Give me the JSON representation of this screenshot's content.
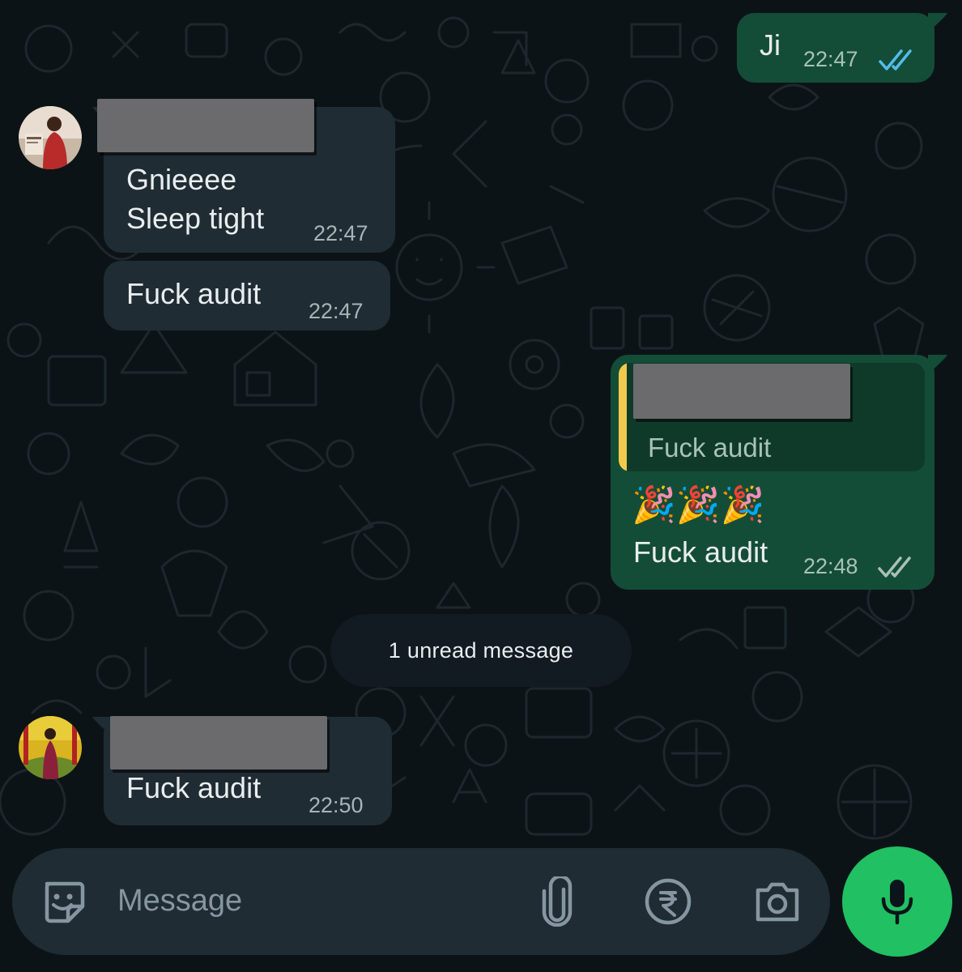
{
  "messages": {
    "out1": {
      "text": "Ji",
      "time": "22:47",
      "status": "read"
    },
    "in1": {
      "text": "Gnieeee\nSleep tight",
      "time": "22:47"
    },
    "in2": {
      "text": "Fuck audit",
      "time": "22:47"
    },
    "out2": {
      "quoted_text": "Fuck audit",
      "emoji": "🎉🎉🎉",
      "text": "Fuck audit",
      "time": "22:48",
      "status": "delivered"
    },
    "in3": {
      "text": "Fuck audit",
      "time": "22:50"
    }
  },
  "unread_divider": "1 unread message",
  "composer": {
    "placeholder": "Message",
    "icons": [
      "sticker-icon",
      "attach-icon",
      "rupee-payment-icon",
      "camera-icon",
      "mic-icon"
    ]
  },
  "colors": {
    "background": "#0c1317",
    "incoming_bubble": "#1f2c33",
    "outgoing_bubble": "#144d37",
    "read_ticks": "#53bdeb",
    "mic_button": "#21c063",
    "quote_bar": "#f2c94c"
  }
}
